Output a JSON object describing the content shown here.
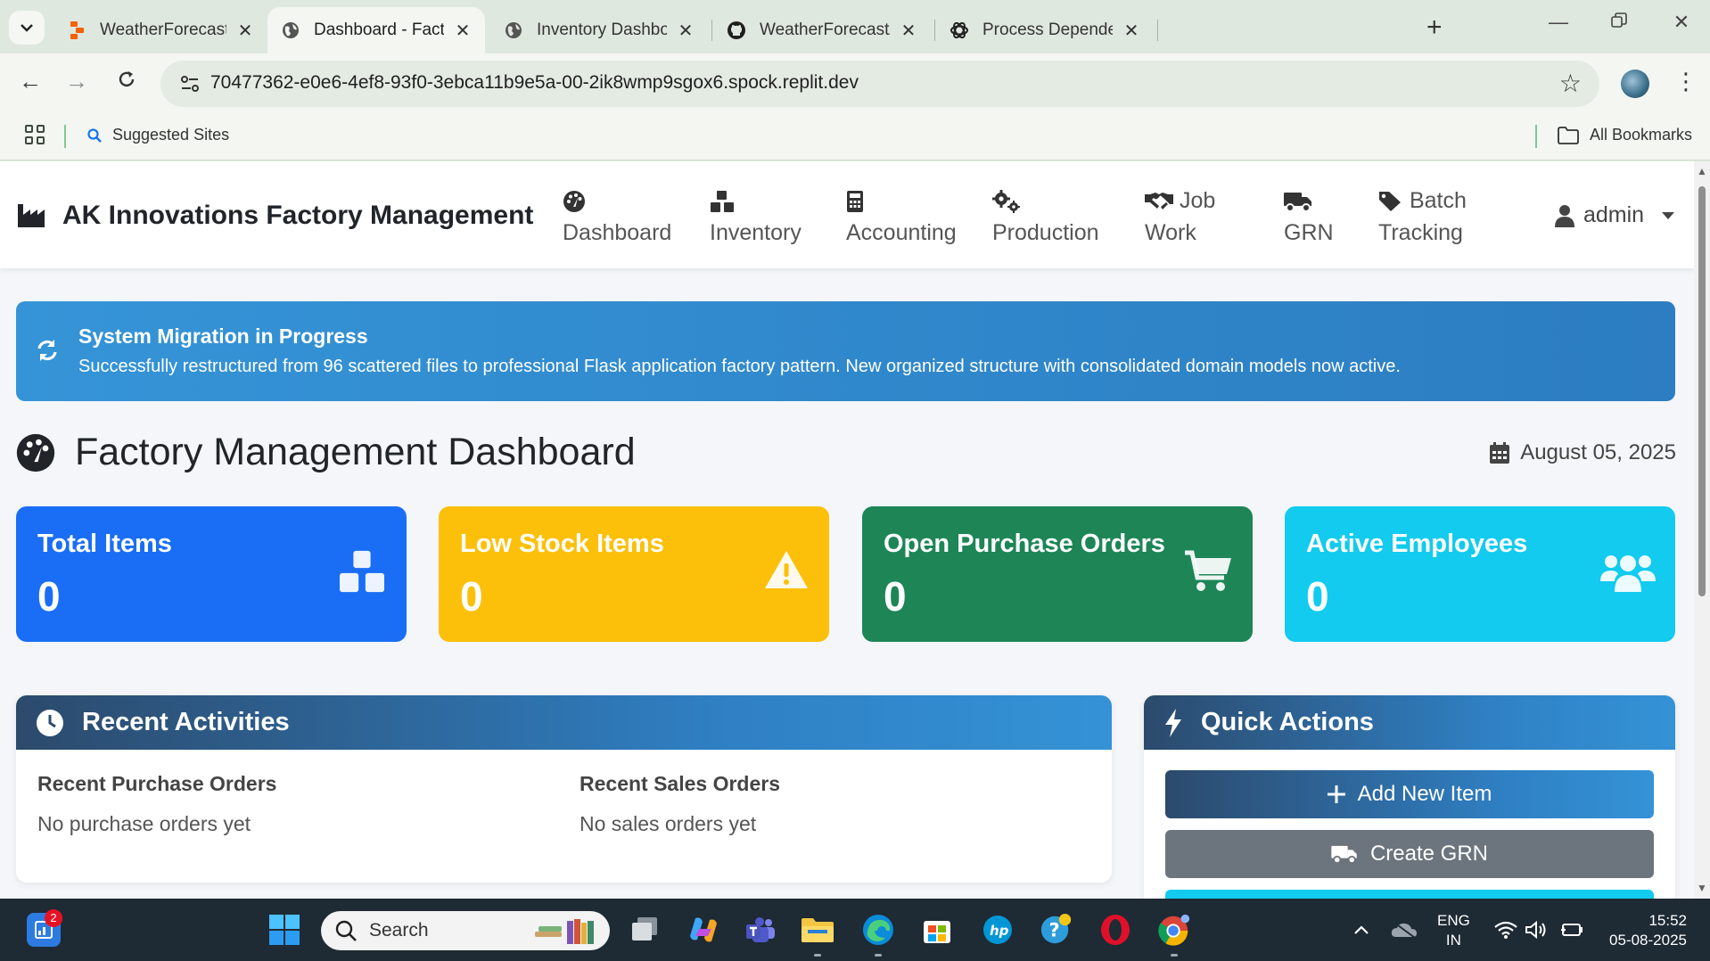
{
  "browser": {
    "tabs": [
      {
        "title": "WeatherForecast - Replit",
        "icon": "replit-icon"
      },
      {
        "title": "Dashboard - Factory Mar",
        "icon": "globe-icon",
        "active": true
      },
      {
        "title": "Inventory Dashboard - AI",
        "icon": "globe-icon"
      },
      {
        "title": "WeatherForecast/attache",
        "icon": "github-icon"
      },
      {
        "title": "Process Dependencies O",
        "icon": "openai-icon"
      }
    ],
    "url": "70477362-e0e6-4ef8-93f0-3ebca11b9e5a-00-2ik8wmp9sgox6.spock.replit.dev",
    "bookmarks": {
      "suggested": "Suggested Sites",
      "all": "All Bookmarks"
    }
  },
  "app": {
    "brand": "AK Innovations Factory Management",
    "nav": [
      {
        "line1": "",
        "line2": "Dashboard",
        "icon": "gauge-icon"
      },
      {
        "line1": "",
        "line2": "Inventory",
        "icon": "boxes-icon"
      },
      {
        "line1": "",
        "line2": "Accounting",
        "icon": "calculator-icon"
      },
      {
        "line1": "",
        "line2": "Production",
        "icon": "gears-icon"
      },
      {
        "line1": "Job",
        "line2": "Work",
        "icon": "handshake-icon"
      },
      {
        "line1": "",
        "line2": "GRN",
        "icon": "truck-icon"
      },
      {
        "line1": "Batch",
        "line2": "Tracking",
        "icon": "tags-icon"
      }
    ],
    "user": "admin"
  },
  "alert": {
    "title": "System Migration in Progress",
    "text": "Successfully restructured from 96 scattered files to professional Flask application factory pattern. New organized structure with consolidated domain models now active."
  },
  "dashboard": {
    "title": "Factory Management Dashboard",
    "date": "August 05, 2025"
  },
  "stats": [
    {
      "label": "Total Items",
      "value": "0",
      "color": "#1a6ef5",
      "icon": "boxes-icon"
    },
    {
      "label": "Low Stock Items",
      "value": "0",
      "color": "#fcc00a",
      "icon": "warning-icon"
    },
    {
      "label": "Open Purchase Orders",
      "value": "0",
      "color": "#1d8556",
      "icon": "cart-icon"
    },
    {
      "label": "Active Employees",
      "value": "0",
      "color": "#12cbef",
      "icon": "users-icon"
    }
  ],
  "recent": {
    "title": "Recent Activities",
    "po_heading": "Recent Purchase Orders",
    "po_empty": "No purchase orders yet",
    "so_heading": "Recent Sales Orders",
    "so_empty": "No sales orders yet"
  },
  "quick": {
    "title": "Quick Actions",
    "add_item": "Add New Item",
    "create_grn": "Create GRN"
  },
  "taskbar": {
    "search": "Search",
    "lang1": "ENG",
    "lang2": "IN",
    "time": "15:52",
    "date": "05-08-2025",
    "notif_count": "2"
  }
}
